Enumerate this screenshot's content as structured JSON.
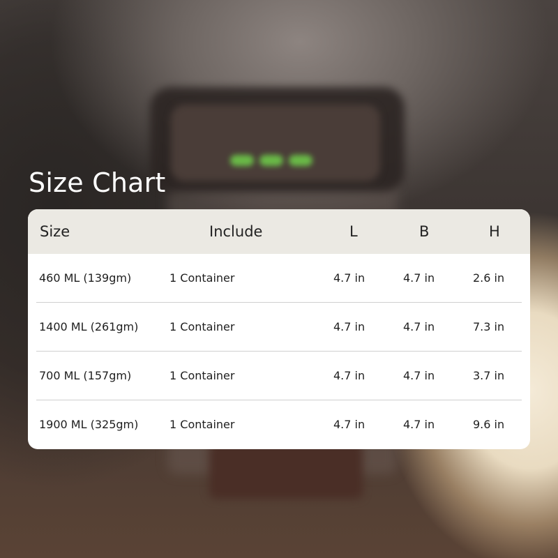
{
  "title": "Size Chart",
  "table": {
    "headers": {
      "size": "Size",
      "include": "Include",
      "l": "L",
      "b": "B",
      "h": "H"
    },
    "rows": [
      {
        "size": "460 ML (139gm)",
        "include": "1 Container",
        "l": "4.7 in",
        "b": "4.7 in",
        "h": "2.6 in"
      },
      {
        "size": "1400 ML (261gm)",
        "include": "1 Container",
        "l": "4.7 in",
        "b": "4.7 in",
        "h": "7.3 in"
      },
      {
        "size": "700 ML (157gm)",
        "include": "1 Container",
        "l": "4.7 in",
        "b": "4.7 in",
        "h": "3.7 in"
      },
      {
        "size": "1900 ML (325gm)",
        "include": "1 Container",
        "l": "4.7 in",
        "b": "4.7 in",
        "h": "9.6 in"
      }
    ]
  },
  "colors": {
    "header_bg": "#ebe9e3",
    "card_bg": "#ffffff",
    "title_text": "#ffffff"
  }
}
